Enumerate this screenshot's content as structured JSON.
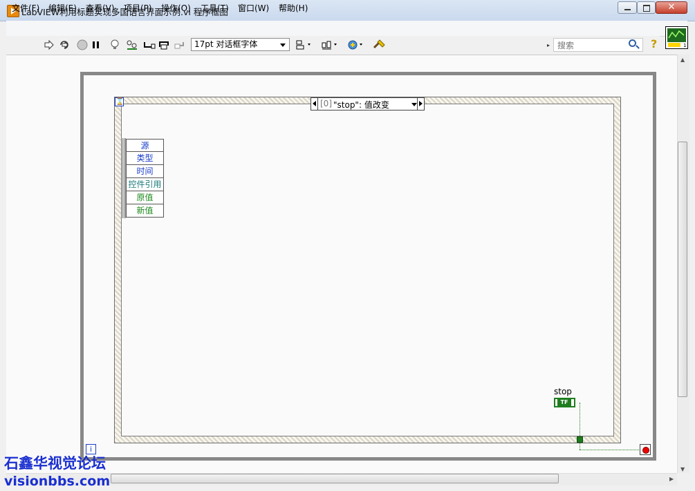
{
  "window": {
    "title": "LabVIEW利用标题实现多国语言界面示例.vi 程序框图",
    "close_glyph": "✕"
  },
  "menu": [
    "文件(F)",
    "编辑(E)",
    "查看(V)",
    "项目(P)",
    "操作(O)",
    "工具(T)",
    "窗口(W)",
    "帮助(H)"
  ],
  "toolbar": {
    "font_select_value": "17pt 对话框字体",
    "search_placeholder": "搜索",
    "help_glyph": "?"
  },
  "diagram": {
    "event_case": {
      "index": "[0]",
      "label": "\"stop\": 值改变"
    },
    "event_data_fields": [
      "源",
      "类型",
      "时间",
      "控件引用",
      "原值",
      "新值"
    ],
    "event_field_colors": [
      "#1a3dc8",
      "#1a3dc8",
      "#1a3dc8",
      "#1a7a7a",
      "#1e8a1e",
      "#1e8a1e"
    ],
    "stop_control_label": "stop",
    "stop_terminal_text": "TF",
    "timeout_glyph": "⌛",
    "iteration_glyph": "i"
  },
  "watermark": {
    "line1": "石鑫华视觉论坛",
    "line2": "visionbbs.com"
  }
}
